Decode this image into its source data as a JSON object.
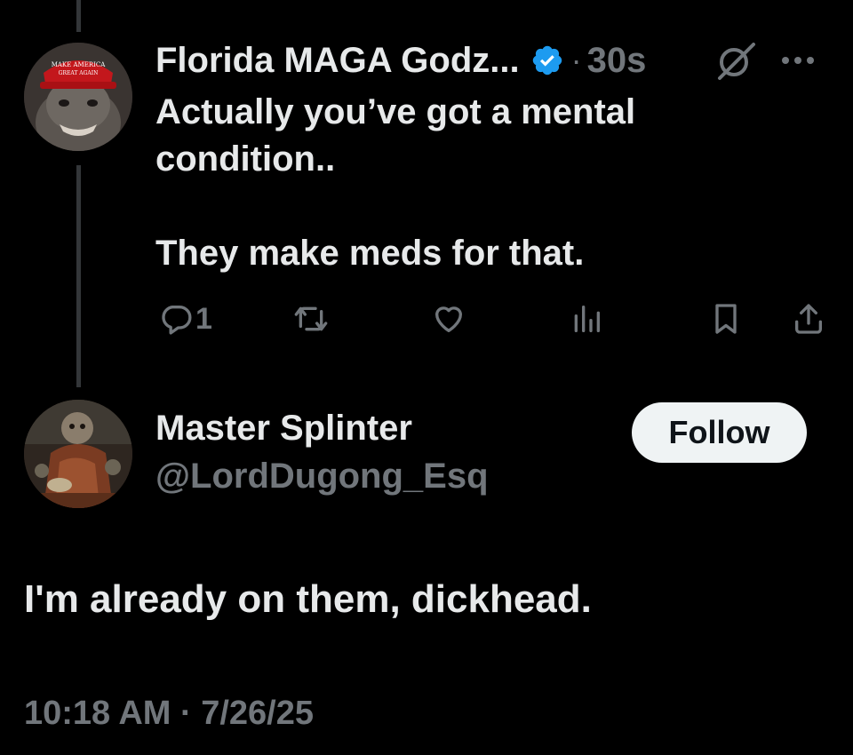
{
  "tweet": {
    "author_name": "Florida MAGA Godz...",
    "dot": "·",
    "time": "30s",
    "avatar_hat_text": "MAKE AMERICA GREAT AGAIN",
    "text_lines": [
      "Actually you’ve got a mental",
      "condition..",
      "They make meds for that."
    ],
    "replies_count": "1",
    "icons": [
      "reply-icon",
      "retweet-icon",
      "like-icon",
      "views-icon",
      "bookmark-icon",
      "share-icon",
      "grok-icon",
      "more-icon",
      "verified-badge-icon"
    ]
  },
  "reply": {
    "author_name": "Master Splinter",
    "handle": "@LordDugong_Esq",
    "follow_label": "Follow",
    "text": "I'm already on them, dickhead.",
    "timestamp": "10:18 AM · 7/26/25"
  },
  "colors": {
    "background": "#000000",
    "text": "#e7e9ea",
    "muted": "#71767b",
    "verified": "#1d9bf0",
    "follow_bg": "#eff3f4"
  }
}
